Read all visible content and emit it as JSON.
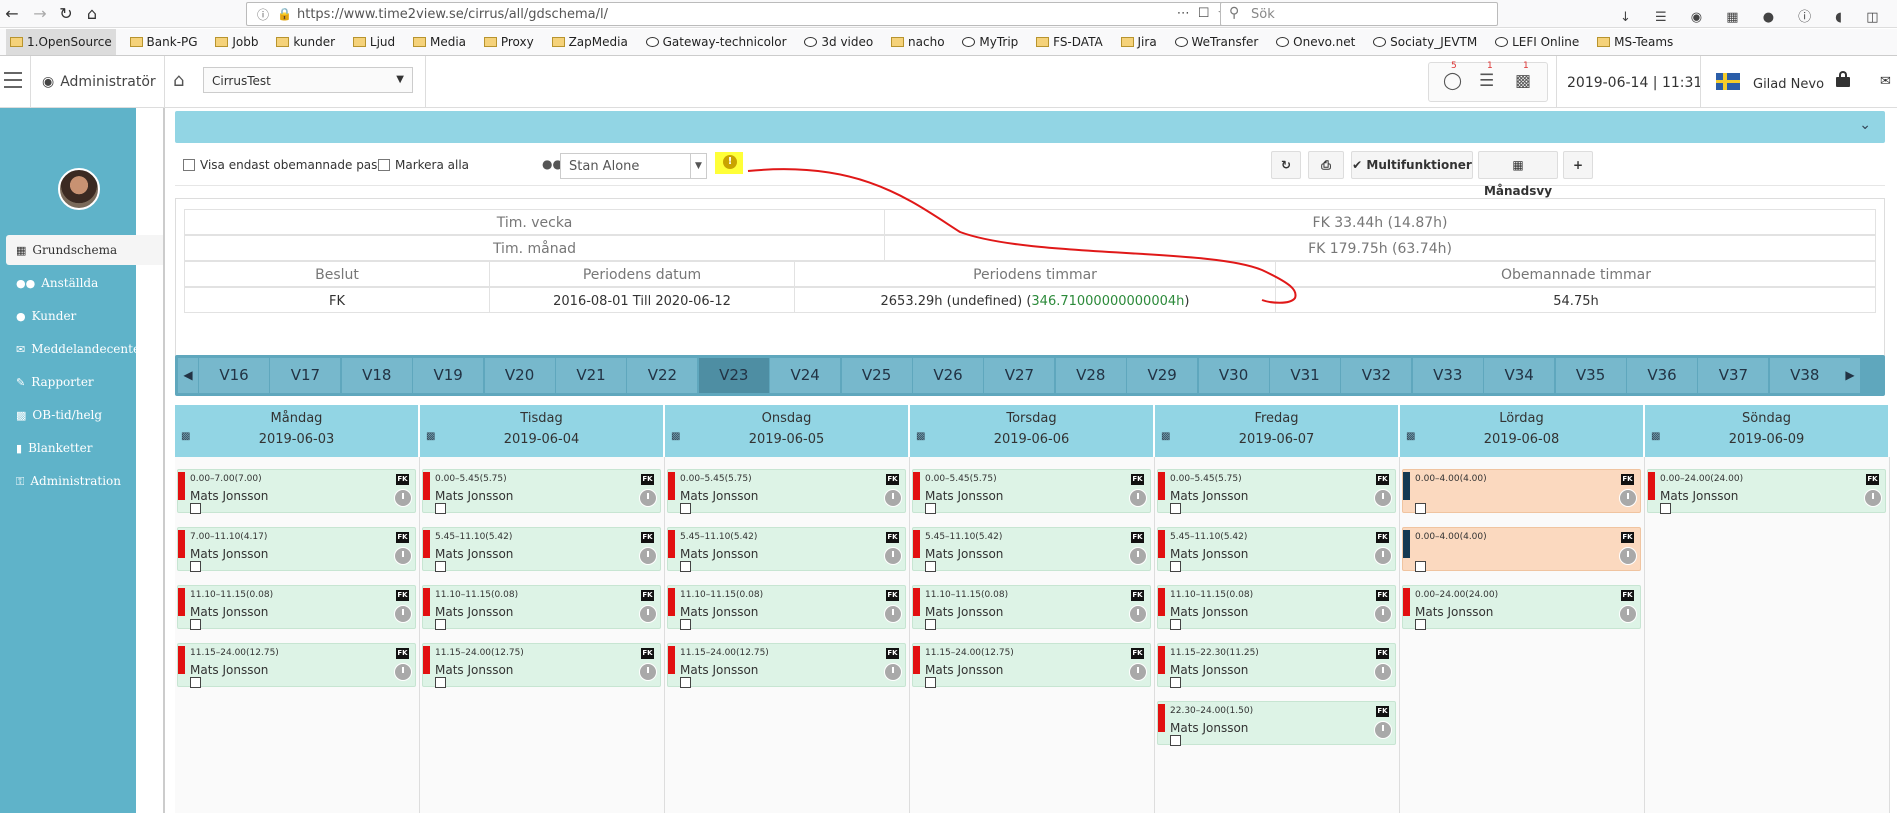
{
  "browser": {
    "url": "https://www.time2view.se/cirrus/all/gdschema/l/",
    "search_placeholder": "Sök",
    "bookmarks": [
      "1.OpenSource",
      "Bank-PG",
      "Jobb",
      "kunder",
      "Ljud",
      "Media",
      "Proxy",
      "ZapMedia",
      "Gateway-technicolor",
      "3d video",
      "nacho",
      "MyTrip",
      "FS-DATA",
      "Jira",
      "WeTransfer",
      "Onevo.net",
      "Sociaty_JEVTM",
      "LEFI Online",
      "MS-Teams"
    ]
  },
  "header": {
    "role": "Administratör",
    "environment": "CirrusTest",
    "datetime": "2019-06-14 | 11:31",
    "user": "Gilad Nevo",
    "stat_badges": [
      "5",
      "1",
      "1"
    ]
  },
  "sidebar": {
    "items": [
      {
        "label": "Grundschema",
        "icon": "calendar-icon"
      },
      {
        "label": "Anställda",
        "icon": "users-icon"
      },
      {
        "label": "Kunder",
        "icon": "user-icon"
      },
      {
        "label": "Meddelandecenter",
        "icon": "envelope-icon"
      },
      {
        "label": "Rapporter",
        "icon": "pencil-icon"
      },
      {
        "label": "OB-tid/helg",
        "icon": "chart-icon"
      },
      {
        "label": "Blanketter",
        "icon": "file-icon"
      },
      {
        "label": "Administration",
        "icon": "key-icon"
      }
    ]
  },
  "toolbar": {
    "only_unmanned": "Visa endast obemannade pass",
    "mark_all": "Markera alla",
    "person": "Stan Alone",
    "multi": "Multifunktioner",
    "month": "Månadsvy",
    "add": "+"
  },
  "summary": {
    "week_label": "Tim. vecka",
    "week_value": "FK 33.44h (14.87h)",
    "month_label": "Tim. månad",
    "month_value": "FK 179.75h (63.74h)",
    "headers": [
      "Beslut",
      "Periodens datum",
      "Periodens timmar",
      "Obemannade timmar"
    ],
    "decision": "FK",
    "period_dates": "2016-08-01 Till 2020-06-12",
    "period_hours_a": "2653.29h (undefined) (",
    "period_hours_b": "346.71000000000004h",
    "period_hours_c": ")",
    "unmanned": "54.75h"
  },
  "weeks": [
    "V16",
    "V17",
    "V18",
    "V19",
    "V20",
    "V21",
    "V22",
    "V23",
    "V24",
    "V25",
    "V26",
    "V27",
    "V28",
    "V29",
    "V30",
    "V31",
    "V32",
    "V33",
    "V34",
    "V35",
    "V36",
    "V37",
    "V38"
  ],
  "current_week": "V23",
  "days": [
    {
      "name": "Måndag",
      "date": "2019-06-03",
      "shifts": [
        {
          "time": "0.00–7.00(7.00)",
          "name": "Mats Jonsson",
          "style": "green"
        },
        {
          "time": "7.00–11.10(4.17)",
          "name": "Mats Jonsson",
          "style": "green"
        },
        {
          "time": "11.10–11.15(0.08)",
          "name": "Mats Jonsson",
          "style": "green"
        },
        {
          "time": "11.15–24.00(12.75)",
          "name": "Mats Jonsson",
          "style": "green"
        }
      ]
    },
    {
      "name": "Tisdag",
      "date": "2019-06-04",
      "shifts": [
        {
          "time": "0.00–5.45(5.75)",
          "name": "Mats Jonsson",
          "style": "green"
        },
        {
          "time": "5.45–11.10(5.42)",
          "name": "Mats Jonsson",
          "style": "green"
        },
        {
          "time": "11.10–11.15(0.08)",
          "name": "Mats Jonsson",
          "style": "green"
        },
        {
          "time": "11.15–24.00(12.75)",
          "name": "Mats Jonsson",
          "style": "green"
        }
      ]
    },
    {
      "name": "Onsdag",
      "date": "2019-06-05",
      "shifts": [
        {
          "time": "0.00–5.45(5.75)",
          "name": "Mats Jonsson",
          "style": "green"
        },
        {
          "time": "5.45–11.10(5.42)",
          "name": "Mats Jonsson",
          "style": "green"
        },
        {
          "time": "11.10–11.15(0.08)",
          "name": "Mats Jonsson",
          "style": "green"
        },
        {
          "time": "11.15–24.00(12.75)",
          "name": "Mats Jonsson",
          "style": "green"
        }
      ]
    },
    {
      "name": "Torsdag",
      "date": "2019-06-06",
      "shifts": [
        {
          "time": "0.00–5.45(5.75)",
          "name": "Mats Jonsson",
          "style": "green"
        },
        {
          "time": "5.45–11.10(5.42)",
          "name": "Mats Jonsson",
          "style": "green"
        },
        {
          "time": "11.10–11.15(0.08)",
          "name": "Mats Jonsson",
          "style": "green"
        },
        {
          "time": "11.15–24.00(12.75)",
          "name": "Mats Jonsson",
          "style": "green"
        }
      ]
    },
    {
      "name": "Fredag",
      "date": "2019-06-07",
      "shifts": [
        {
          "time": "0.00–5.45(5.75)",
          "name": "Mats Jonsson",
          "style": "green"
        },
        {
          "time": "5.45–11.10(5.42)",
          "name": "Mats Jonsson",
          "style": "green"
        },
        {
          "time": "11.10–11.15(0.08)",
          "name": "Mats Jonsson",
          "style": "green"
        },
        {
          "time": "11.15–22.30(11.25)",
          "name": "Mats Jonsson",
          "style": "green"
        },
        {
          "time": "22.30–24.00(1.50)",
          "name": "Mats Jonsson",
          "style": "green"
        }
      ]
    },
    {
      "name": "Lördag",
      "date": "2019-06-08",
      "shifts": [
        {
          "time": "0.00–4.00(4.00)",
          "name": "",
          "style": "orange"
        },
        {
          "time": "0.00–4.00(4.00)",
          "name": "",
          "style": "orange"
        },
        {
          "time": "0.00–24.00(24.00)",
          "name": "Mats Jonsson",
          "style": "green"
        }
      ]
    },
    {
      "name": "Söndag",
      "date": "2019-06-09",
      "shifts": [
        {
          "time": "0.00–24.00(24.00)",
          "name": "Mats Jonsson",
          "style": "green"
        }
      ]
    }
  ],
  "shift_tag": "FK",
  "colors": {
    "sidebar": "#5fb3c9",
    "header_band": "#92d5e4",
    "week_nav": "#5fa7bd",
    "shift_green": "#ddf3e6",
    "shift_orange": "#fbd9bf",
    "marker_red": "#e21010",
    "annotation": "#e01818"
  }
}
